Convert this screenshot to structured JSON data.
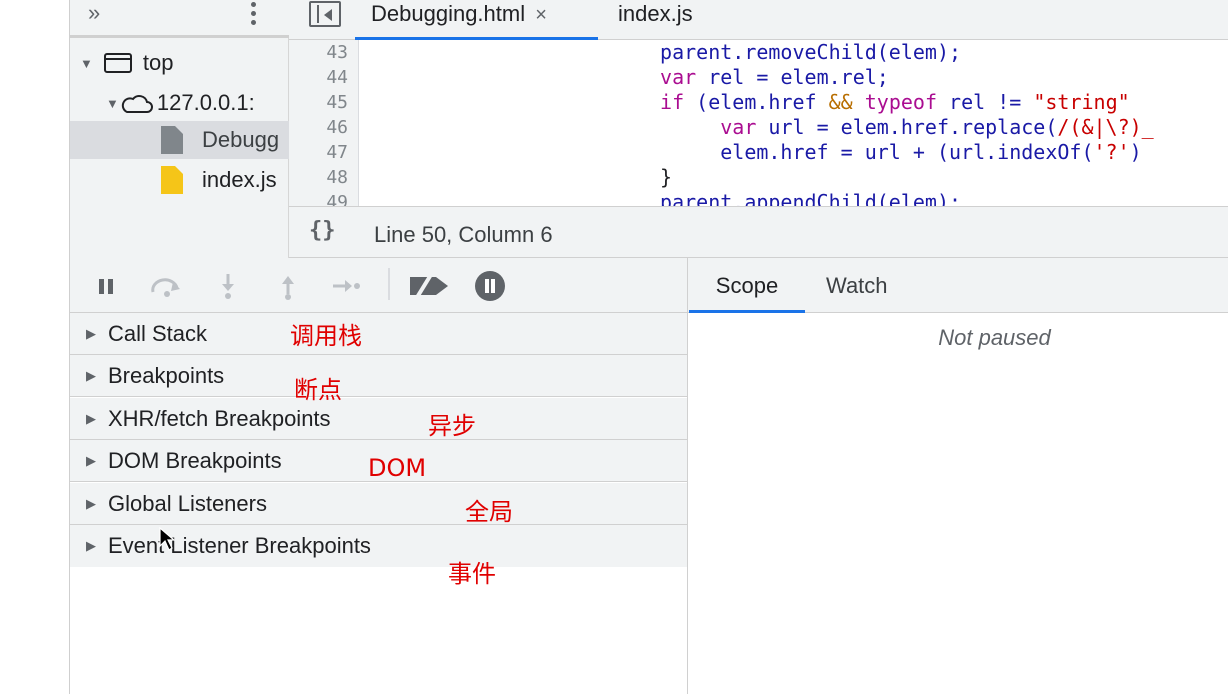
{
  "navigator": {
    "more_label": "»",
    "tree": [
      {
        "label": "top",
        "expanded": true,
        "icon": "frame-icon"
      },
      {
        "label": "127.0.0.1:",
        "expanded": true,
        "icon": "cloud-icon"
      },
      {
        "label": "Debugg",
        "icon": "file-icon",
        "selected": true
      },
      {
        "label": "index.js",
        "icon": "js-file-icon"
      }
    ]
  },
  "editor": {
    "tabs": [
      {
        "label": "Debugging.html",
        "close": "×",
        "active": true
      },
      {
        "label": "index.js",
        "active": false
      }
    ],
    "line_numbers": [
      "43",
      "44",
      "45",
      "46",
      "47",
      "48",
      "49"
    ],
    "status_icon": "{}",
    "status": "Line 50, Column 6"
  },
  "debugger": {
    "sections": [
      {
        "label": "Call Stack",
        "annotation": "调用栈"
      },
      {
        "label": "Breakpoints",
        "annotation": "断点"
      },
      {
        "label": "XHR/fetch Breakpoints",
        "annotation": "异步"
      },
      {
        "label": "DOM Breakpoints",
        "annotation": "DOM"
      },
      {
        "label": "Global Listeners",
        "annotation": "全局"
      },
      {
        "label": "Event Listener Breakpoints",
        "annotation": "事件"
      }
    ]
  },
  "scope_pane": {
    "tabs": [
      "Scope",
      "Watch"
    ],
    "message": "Not paused"
  },
  "colors": {
    "accent": "#1a73e8",
    "annotation": "#e00000",
    "panel_bg": "#f1f3f4"
  }
}
